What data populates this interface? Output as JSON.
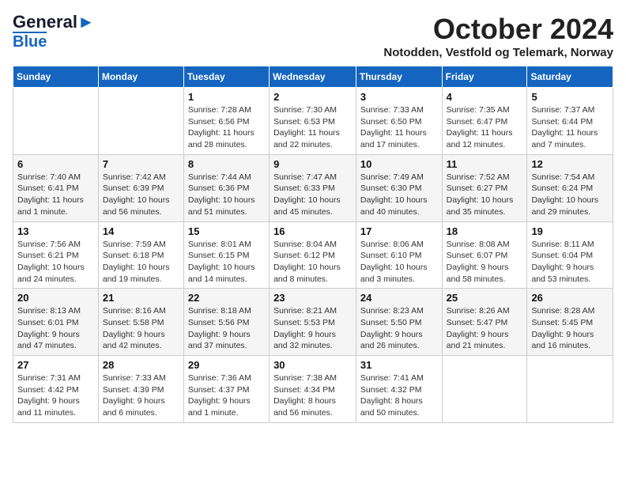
{
  "header": {
    "logo_line1": "General",
    "logo_line2": "Blue",
    "month": "October 2024",
    "location": "Notodden, Vestfold og Telemark, Norway"
  },
  "days_of_week": [
    "Sunday",
    "Monday",
    "Tuesday",
    "Wednesday",
    "Thursday",
    "Friday",
    "Saturday"
  ],
  "weeks": [
    [
      {
        "day": null,
        "content": ""
      },
      {
        "day": null,
        "content": ""
      },
      {
        "day": "1",
        "content": "Sunrise: 7:28 AM\nSunset: 6:56 PM\nDaylight: 11 hours and 28 minutes."
      },
      {
        "day": "2",
        "content": "Sunrise: 7:30 AM\nSunset: 6:53 PM\nDaylight: 11 hours and 22 minutes."
      },
      {
        "day": "3",
        "content": "Sunrise: 7:33 AM\nSunset: 6:50 PM\nDaylight: 11 hours and 17 minutes."
      },
      {
        "day": "4",
        "content": "Sunrise: 7:35 AM\nSunset: 6:47 PM\nDaylight: 11 hours and 12 minutes."
      },
      {
        "day": "5",
        "content": "Sunrise: 7:37 AM\nSunset: 6:44 PM\nDaylight: 11 hours and 7 minutes."
      }
    ],
    [
      {
        "day": "6",
        "content": "Sunrise: 7:40 AM\nSunset: 6:41 PM\nDaylight: 11 hours and 1 minute."
      },
      {
        "day": "7",
        "content": "Sunrise: 7:42 AM\nSunset: 6:39 PM\nDaylight: 10 hours and 56 minutes."
      },
      {
        "day": "8",
        "content": "Sunrise: 7:44 AM\nSunset: 6:36 PM\nDaylight: 10 hours and 51 minutes."
      },
      {
        "day": "9",
        "content": "Sunrise: 7:47 AM\nSunset: 6:33 PM\nDaylight: 10 hours and 45 minutes."
      },
      {
        "day": "10",
        "content": "Sunrise: 7:49 AM\nSunset: 6:30 PM\nDaylight: 10 hours and 40 minutes."
      },
      {
        "day": "11",
        "content": "Sunrise: 7:52 AM\nSunset: 6:27 PM\nDaylight: 10 hours and 35 minutes."
      },
      {
        "day": "12",
        "content": "Sunrise: 7:54 AM\nSunset: 6:24 PM\nDaylight: 10 hours and 29 minutes."
      }
    ],
    [
      {
        "day": "13",
        "content": "Sunrise: 7:56 AM\nSunset: 6:21 PM\nDaylight: 10 hours and 24 minutes."
      },
      {
        "day": "14",
        "content": "Sunrise: 7:59 AM\nSunset: 6:18 PM\nDaylight: 10 hours and 19 minutes."
      },
      {
        "day": "15",
        "content": "Sunrise: 8:01 AM\nSunset: 6:15 PM\nDaylight: 10 hours and 14 minutes."
      },
      {
        "day": "16",
        "content": "Sunrise: 8:04 AM\nSunset: 6:12 PM\nDaylight: 10 hours and 8 minutes."
      },
      {
        "day": "17",
        "content": "Sunrise: 8:06 AM\nSunset: 6:10 PM\nDaylight: 10 hours and 3 minutes."
      },
      {
        "day": "18",
        "content": "Sunrise: 8:08 AM\nSunset: 6:07 PM\nDaylight: 9 hours and 58 minutes."
      },
      {
        "day": "19",
        "content": "Sunrise: 8:11 AM\nSunset: 6:04 PM\nDaylight: 9 hours and 53 minutes."
      }
    ],
    [
      {
        "day": "20",
        "content": "Sunrise: 8:13 AM\nSunset: 6:01 PM\nDaylight: 9 hours and 47 minutes."
      },
      {
        "day": "21",
        "content": "Sunrise: 8:16 AM\nSunset: 5:58 PM\nDaylight: 9 hours and 42 minutes."
      },
      {
        "day": "22",
        "content": "Sunrise: 8:18 AM\nSunset: 5:56 PM\nDaylight: 9 hours and 37 minutes."
      },
      {
        "day": "23",
        "content": "Sunrise: 8:21 AM\nSunset: 5:53 PM\nDaylight: 9 hours and 32 minutes."
      },
      {
        "day": "24",
        "content": "Sunrise: 8:23 AM\nSunset: 5:50 PM\nDaylight: 9 hours and 26 minutes."
      },
      {
        "day": "25",
        "content": "Sunrise: 8:26 AM\nSunset: 5:47 PM\nDaylight: 9 hours and 21 minutes."
      },
      {
        "day": "26",
        "content": "Sunrise: 8:28 AM\nSunset: 5:45 PM\nDaylight: 9 hours and 16 minutes."
      }
    ],
    [
      {
        "day": "27",
        "content": "Sunrise: 7:31 AM\nSunset: 4:42 PM\nDaylight: 9 hours and 11 minutes."
      },
      {
        "day": "28",
        "content": "Sunrise: 7:33 AM\nSunset: 4:39 PM\nDaylight: 9 hours and 6 minutes."
      },
      {
        "day": "29",
        "content": "Sunrise: 7:36 AM\nSunset: 4:37 PM\nDaylight: 9 hours and 1 minute."
      },
      {
        "day": "30",
        "content": "Sunrise: 7:38 AM\nSunset: 4:34 PM\nDaylight: 8 hours and 56 minutes."
      },
      {
        "day": "31",
        "content": "Sunrise: 7:41 AM\nSunset: 4:32 PM\nDaylight: 8 hours and 50 minutes."
      },
      {
        "day": null,
        "content": ""
      },
      {
        "day": null,
        "content": ""
      }
    ]
  ]
}
